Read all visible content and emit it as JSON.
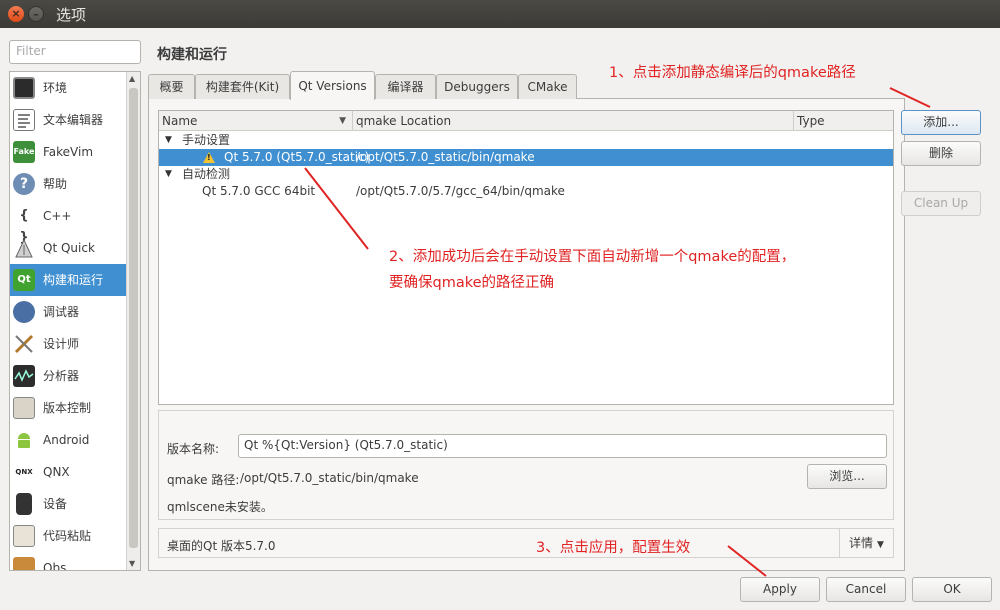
{
  "window": {
    "title": "选项",
    "close_glyph": "×",
    "min_glyph": "–"
  },
  "filter": {
    "placeholder": "Filter"
  },
  "sidebar": {
    "items": [
      {
        "label": "环境",
        "icon": "monitor-icon"
      },
      {
        "label": "文本编辑器",
        "icon": "text-editor-icon"
      },
      {
        "label": "FakeVim",
        "icon": "fakevim-icon"
      },
      {
        "label": "帮助",
        "icon": "help-icon"
      },
      {
        "label": "C++",
        "icon": "cpp-braces-icon"
      },
      {
        "label": "Qt Quick",
        "icon": "qt-quick-icon"
      },
      {
        "label": "构建和运行",
        "icon": "qt-build-icon"
      },
      {
        "label": "调试器",
        "icon": "debugger-icon"
      },
      {
        "label": "设计师",
        "icon": "designer-icon"
      },
      {
        "label": "分析器",
        "icon": "analyzer-icon"
      },
      {
        "label": "版本控制",
        "icon": "version-control-icon"
      },
      {
        "label": "Android",
        "icon": "android-icon"
      },
      {
        "label": "QNX",
        "icon": "qnx-icon"
      },
      {
        "label": "设备",
        "icon": "device-icon"
      },
      {
        "label": "代码粘贴",
        "icon": "code-paste-icon"
      },
      {
        "label": "Qbs",
        "icon": "qbs-icon"
      }
    ],
    "active_index": 6,
    "icon_text": {
      "fakevim": "Fake",
      "help": "?",
      "cpp": "{ }",
      "qt": "Qt",
      "qnx": "QNX"
    }
  },
  "main": {
    "title": "构建和运行",
    "tabs": [
      "概要",
      "构建套件(Kit)",
      "Qt Versions",
      "编译器",
      "Debuggers",
      "CMake"
    ],
    "active_tab": 2
  },
  "table": {
    "headers": [
      "Name",
      "qmake Location",
      "Type"
    ],
    "sort_glyph": "▼",
    "groups": [
      {
        "label": "手动设置",
        "rows": [
          {
            "name": "Qt 5.7.0 (Qt5.7.0_static)",
            "location": "/opt/Qt5.7.0_static/bin/qmake",
            "warning": true
          }
        ]
      },
      {
        "label": "自动检测",
        "rows": [
          {
            "name": "Qt 5.7.0 GCC 64bit",
            "location": "/opt/Qt5.7.0/5.7/gcc_64/bin/qmake",
            "warning": false
          }
        ]
      }
    ],
    "expand_glyph": "▼",
    "warning_glyph": "!"
  },
  "buttons": {
    "add": "添加...",
    "remove": "删除",
    "cleanup": "Clean Up"
  },
  "details": {
    "name_label": "版本名称:",
    "name_value": "Qt %{Qt:Version} (Qt5.7.0_static)",
    "qmake_label": "qmake 路径:",
    "qmake_value": "/opt/Qt5.7.0_static/bin/qmake",
    "browse": "浏览...",
    "qmlscene": "qmlscene未安装。"
  },
  "status": {
    "text": "桌面的Qt 版本5.7.0",
    "details": "详情",
    "details_glyph": "▼"
  },
  "dialog_buttons": {
    "apply": "Apply",
    "cancel": "Cancel",
    "ok": "OK"
  },
  "annotations": {
    "a1": "1、点击添加静态编译后的qmake路径",
    "a2_line1": "2、添加成功后会在手动设置下面自动新增一个qmake的配置，",
    "a2_line2": "要确保qmake的路径正确",
    "a3": "3、点击应用，配置生效"
  },
  "colors": {
    "selection": "#3f8fd1",
    "annotation": "#e02323",
    "titlebar": "#3c3b37"
  }
}
